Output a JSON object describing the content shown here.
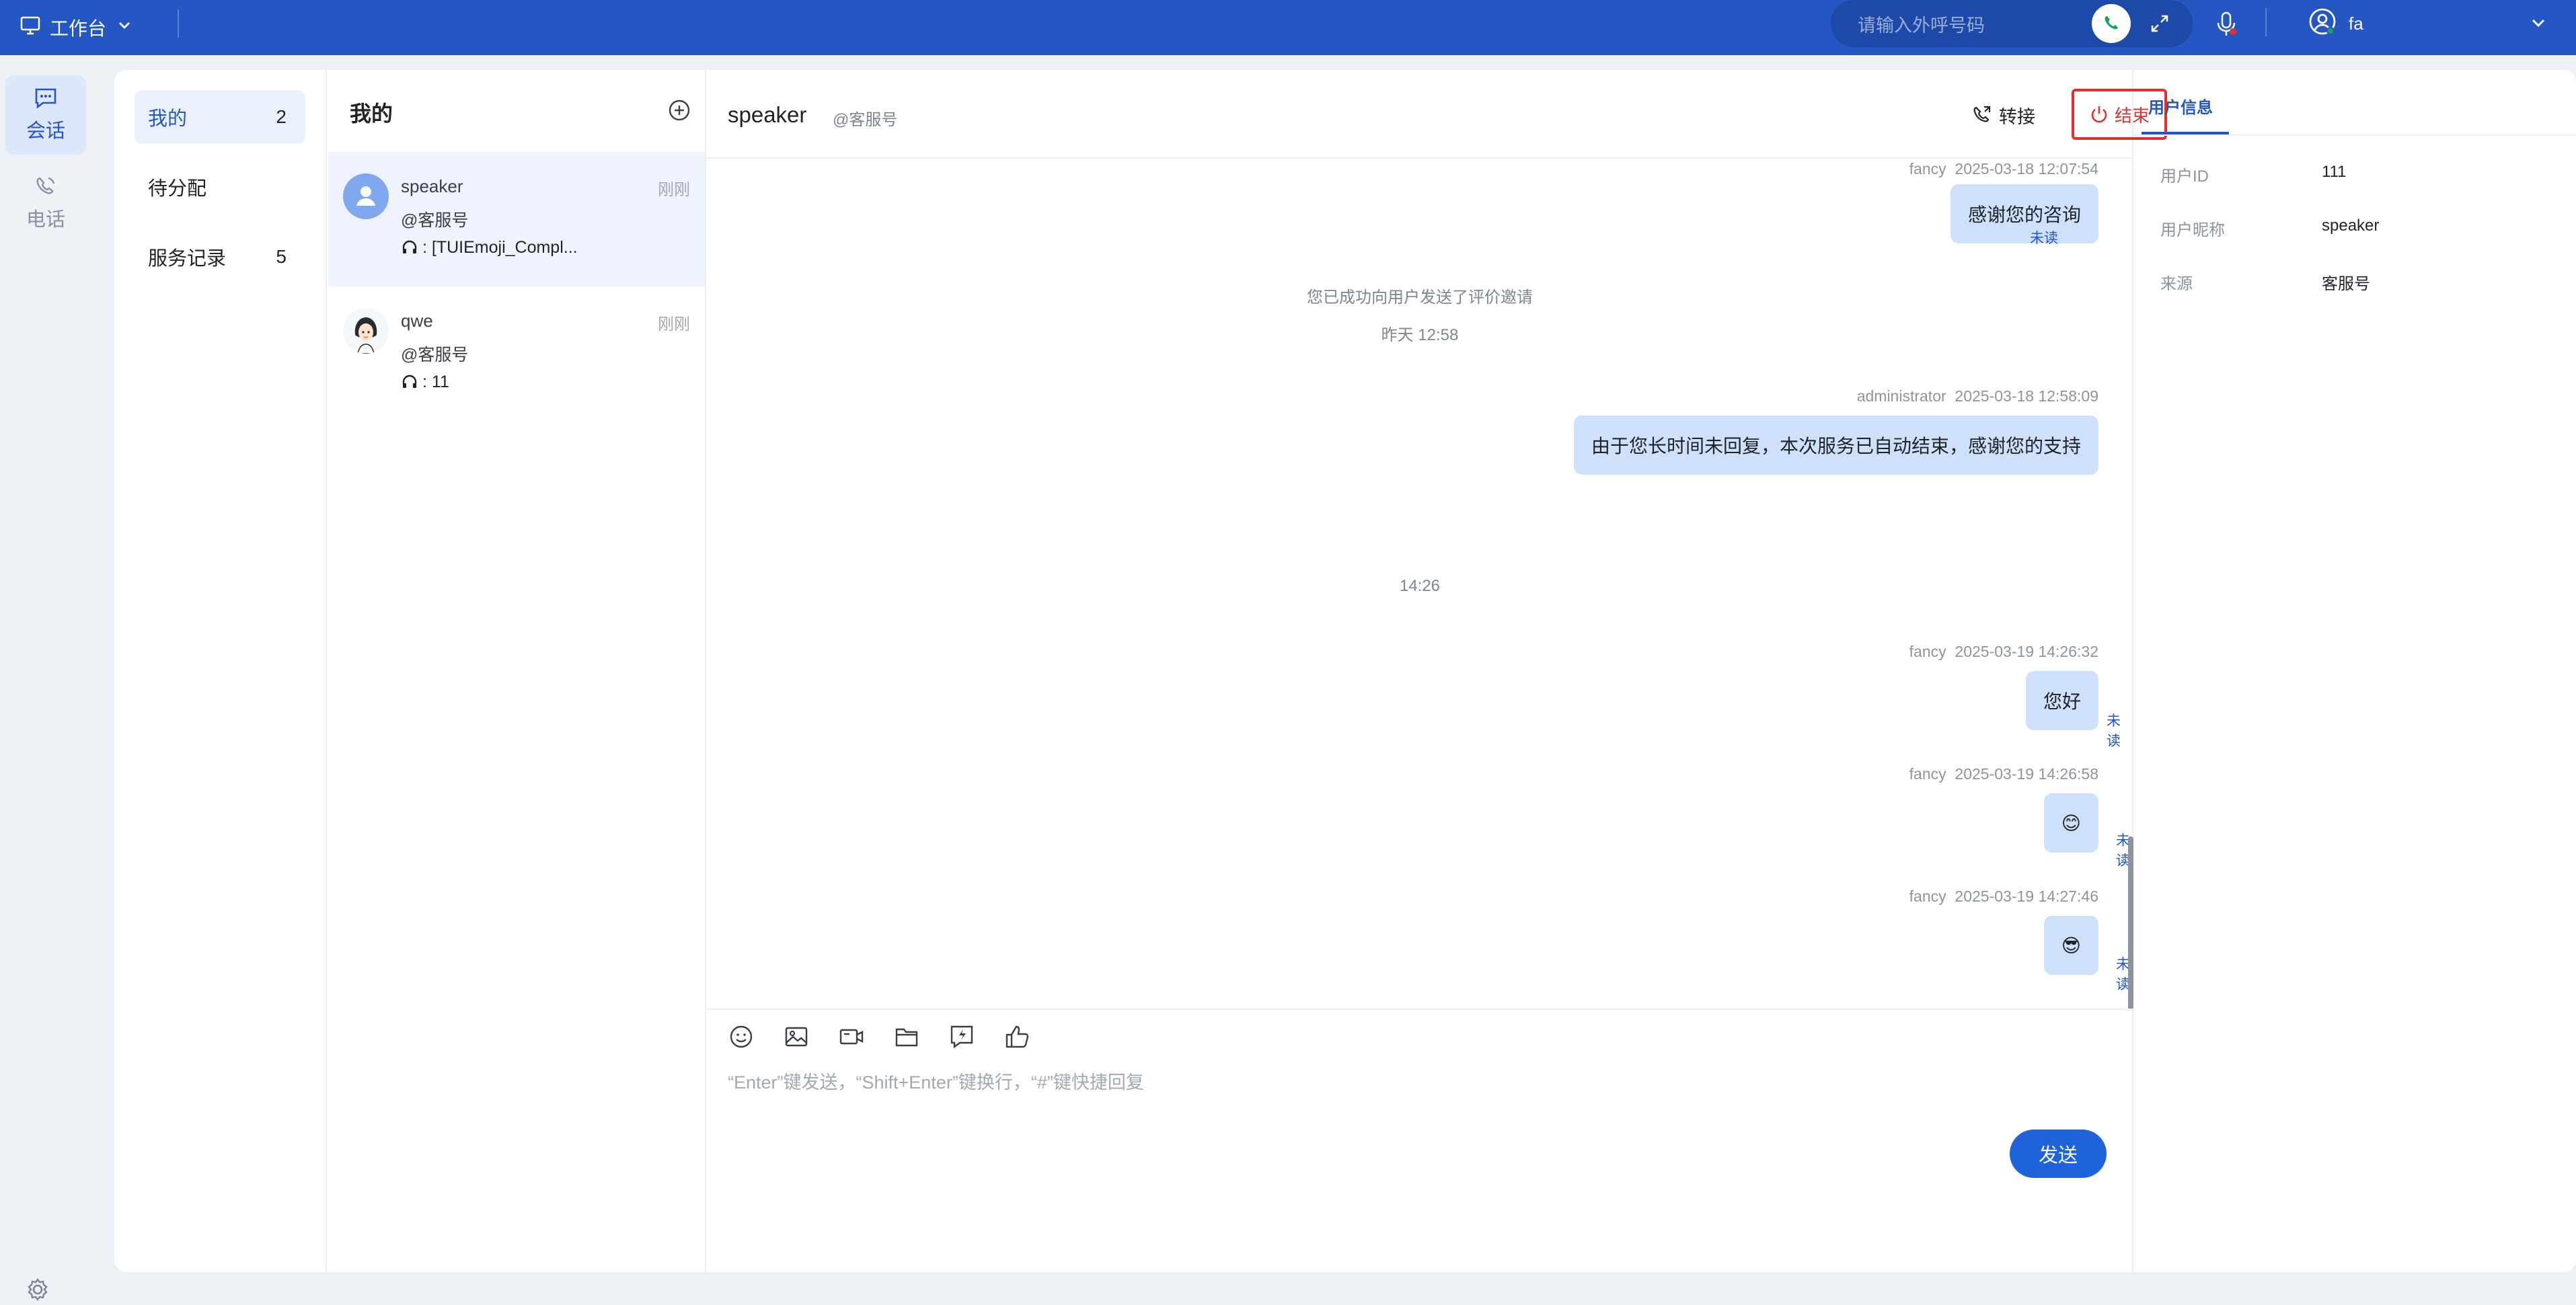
{
  "topbar": {
    "workbench_label": "工作台",
    "dial_placeholder": "请输入外呼号码",
    "username": "fa"
  },
  "rail": {
    "items": [
      {
        "label": "会话",
        "icon": "chat-icon",
        "active": true
      },
      {
        "label": "电话",
        "icon": "phone-icon",
        "active": false
      }
    ]
  },
  "categories": [
    {
      "label": "我的",
      "count": "2",
      "active": true
    },
    {
      "label": "待分配",
      "count": "",
      "active": false
    },
    {
      "label": "服务记录",
      "count": "5",
      "active": false
    }
  ],
  "conversations": {
    "title": "我的",
    "items": [
      {
        "name": "speaker",
        "tag": "@客服号",
        "last": ": [TUIEmoji_Compl...",
        "time": "刚刚",
        "avatar": "default-user-avatar"
      },
      {
        "name": "qwe",
        "tag": "@客服号",
        "last": ": 11",
        "time": "刚刚",
        "avatar": "cartoon-woman-avatar"
      }
    ]
  },
  "chat": {
    "title": "speaker",
    "subtitle": "@客服号",
    "transfer_label": "转接",
    "end_label": "结束",
    "messages": [
      {
        "type": "msg",
        "sender": "fancy",
        "time": "2025-03-18 12:07:54",
        "text": "感谢您的咨询",
        "status": "未读"
      },
      {
        "type": "sys",
        "text": "您已成功向用户发送了评价邀请"
      },
      {
        "type": "sys",
        "text": "昨天 12:58"
      },
      {
        "type": "msg",
        "sender": "administrator",
        "time": "2025-03-18 12:58:09",
        "text": "由于您长时间未回复，本次服务已自动结束，感谢您的支持",
        "status": ""
      },
      {
        "type": "sys",
        "text": "14:26"
      },
      {
        "type": "msg",
        "sender": "fancy",
        "time": "2025-03-19 14:26:32",
        "text": "您好",
        "status": "未读"
      },
      {
        "type": "msg",
        "sender": "fancy",
        "time": "2025-03-19 14:26:58",
        "text": "😊",
        "status": "未读"
      },
      {
        "type": "msg",
        "sender": "fancy",
        "time": "2025-03-19 14:27:46",
        "text": "😎",
        "status": "未读"
      }
    ],
    "composer_placeholder": "“Enter”键发送，“Shift+Enter”键换行，“#”键快捷回复",
    "send_label": "发送",
    "tools": [
      "emoji-icon",
      "image-icon",
      "video-icon",
      "folder-icon",
      "quick-reply-icon",
      "thumbs-up-icon"
    ]
  },
  "user_info": {
    "tab_label": "用户信息",
    "fields": [
      {
        "label": "用户ID",
        "value": "111"
      },
      {
        "label": "用户昵称",
        "value": "speaker"
      },
      {
        "label": "来源",
        "value": "客服号"
      }
    ]
  },
  "colors": {
    "brand": "#2456c4",
    "bubble": "#cfe0fb",
    "danger": "#e03131",
    "send": "#1f63db"
  }
}
